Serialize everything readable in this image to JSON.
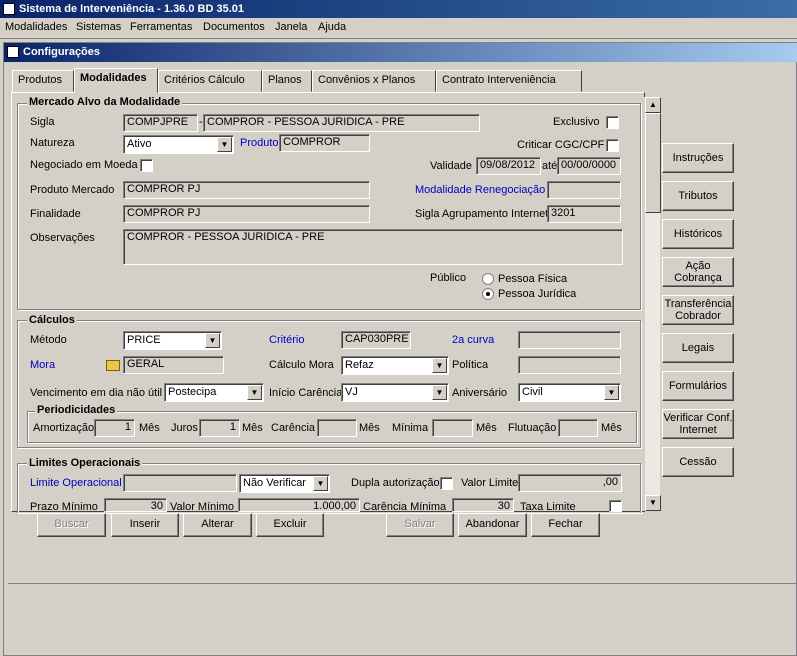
{
  "window": {
    "title": "Sistema de Interveniência - 1.36.0 BD 35.01"
  },
  "menu": [
    "Modalidades",
    "Sistemas",
    "Ferramentas",
    "Documentos",
    "Janela",
    "Ajuda"
  ],
  "child_window": {
    "title": "Configurações"
  },
  "tabs": [
    "Produtos",
    "Modalidades",
    "Critérios Cálculo",
    "Planos",
    "Convênios x Planos",
    "Contrato Interveniência"
  ],
  "active_tab": "Modalidades",
  "mercado": {
    "title": "Mercado Alvo da Modalidade",
    "sigla_label": "Sigla",
    "sigla_value": "COMPJPRE",
    "sigla_sep": "-",
    "sigla_desc": "COMPROR - PESSOA JURIDICA - PRE",
    "exclusivo_label": "Exclusivo",
    "natureza_label": "Natureza",
    "natureza_value": "Ativo",
    "produto_label": "Produto",
    "produto_value": "COMPROR",
    "criticar_label": "Criticar CGC/CPF",
    "negociado_label": "Negociado em Moeda",
    "validade_label": "Validade",
    "validade_de": "09/08/2012",
    "ate_label": "até",
    "validade_ate": "00/00/0000",
    "produto_mercado_label": "Produto Mercado",
    "produto_mercado_value": "COMPROR PJ",
    "mod_reneg_label": "Modalidade Renegociação",
    "mod_reneg_value": "",
    "finalidade_label": "Finalidade",
    "finalidade_value": "COMPROR PJ",
    "sigla_agrup_label": "Sigla Agrupamento Internet",
    "sigla_agrup_value": "3201",
    "observacoes_label": "Observações",
    "observacoes_value": "COMPROR - PESSOA JURIDICA - PRE",
    "publico_label": "Público",
    "pessoa_fisica": "Pessoa Física",
    "pessoa_juridica": "Pessoa Jurídica",
    "publico_selected": "Pessoa Jurídica"
  },
  "calculos": {
    "title": "Cálculos",
    "metodo_label": "Método",
    "metodo_value": "PRICE",
    "criterio_label": "Critério",
    "criterio_value": "CAP030PRE",
    "curva_label": "2a curva",
    "curva_value": "",
    "mora_label": "Mora",
    "mora_value": "GERAL",
    "calculo_mora_label": "Cálculo Mora",
    "calculo_mora_value": "Refaz",
    "politica_label": "Política",
    "politica_value": "",
    "vencimento_label": "Vencimento em dia não útil",
    "vencimento_value": "Postecipa",
    "inicio_carencia_label": "Início Carência",
    "inicio_carencia_value": "VJ",
    "aniversario_label": "Aniversário",
    "aniversario_value": "Civil"
  },
  "periodicidades": {
    "title": "Periodicidades",
    "amortizacao_label": "Amortização",
    "amortizacao_value": "1",
    "mes1": "Mês",
    "juros_label": "Juros",
    "juros_value": "1",
    "mes2": "Mês",
    "carencia_label": "Carência",
    "carencia_value": "",
    "mes3": "Mês",
    "minima_label": "Mínima",
    "minima_value": "",
    "mes4": "Mês",
    "flutuacao_label": "Flutuação",
    "flutuacao_value": "",
    "mes5": "Mês"
  },
  "limites": {
    "title": "Limites Operacionais",
    "limite_op_label": "Limite Operacional",
    "limite_op_value": "",
    "nao_verificar": "Não Verificar",
    "dupla_label": "Dupla autorização",
    "valor_limite_label": "Valor Limite",
    "valor_limite_value": ",00",
    "prazo_min_label": "Prazo Mínimo",
    "prazo_min_value": "30",
    "valor_min_label": "Valor Mínimo",
    "valor_min_value": "1.000,00",
    "carencia_min_label": "Carência Mínima",
    "carencia_min_value": "30",
    "taxa_limite_label": "Taxa Limite"
  },
  "side_buttons": [
    "Instruções",
    "Tributos",
    "Históricos",
    "Ação Cobrança",
    "Transferência Cobrador",
    "Legais",
    "Formulários",
    "Verificar Conf. Internet",
    "Cessão"
  ],
  "bottom_buttons": {
    "buscar": "Buscar",
    "inserir": "Inserir",
    "alterar": "Alterar",
    "excluir": "Excluir",
    "salvar": "Salvar",
    "abandonar": "Abandonar",
    "fechar": "Fechar"
  },
  "colors": {
    "titlebar": "#0a246a",
    "label_link": "#0000c0",
    "face": "#d4d0c8"
  }
}
